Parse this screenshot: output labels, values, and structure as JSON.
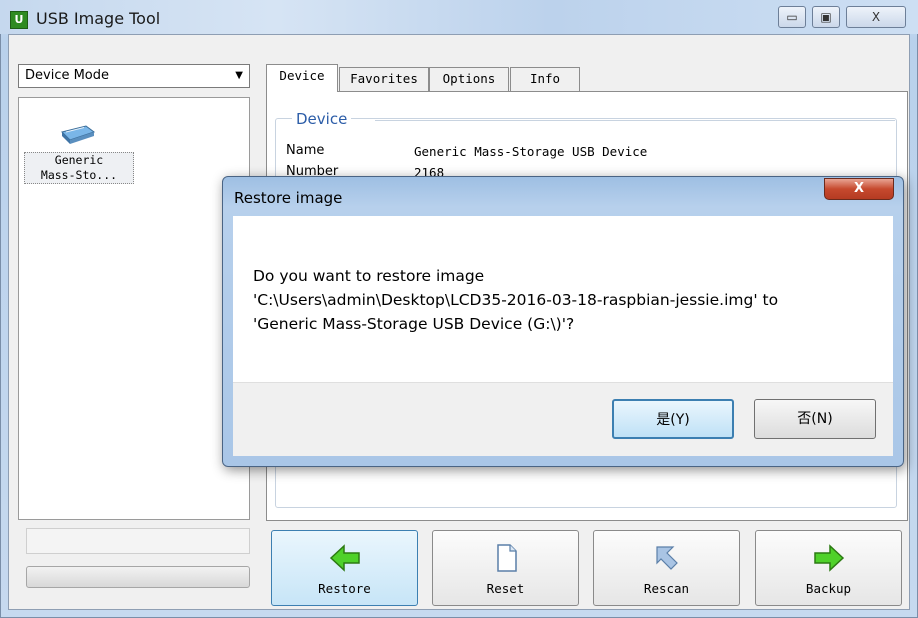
{
  "window": {
    "title": "USB Image Tool",
    "app_icon": "U",
    "minimize": "▭",
    "maximize": "▣",
    "close": "X"
  },
  "left_panel": {
    "mode_select": "Device Mode",
    "devices": [
      {
        "label_line1": "Generic",
        "label_line2": "Mass-Sto...",
        "icon": "usb-drive-icon"
      }
    ]
  },
  "tabs": [
    "Device",
    "Favorites",
    "Options",
    "Info"
  ],
  "device_panel": {
    "group_title": "Device",
    "rows": [
      {
        "label": "Name",
        "value": "Generic Mass-Storage USB Device"
      },
      {
        "label": "Number",
        "value": "2168"
      }
    ]
  },
  "buttons": [
    {
      "label": "Restore",
      "icon": "green-arrow-left-icon"
    },
    {
      "label": "Reset",
      "icon": "document-icon"
    },
    {
      "label": "Rescan",
      "icon": "rescan-arrow-icon"
    },
    {
      "label": "Backup",
      "icon": "green-arrow-right-icon"
    }
  ],
  "dialog": {
    "title": "Restore image",
    "close": "X",
    "message_line1": "Do you want to restore image",
    "message_line2": "'C:\\Users\\admin\\Desktop\\LCD35-2016-03-18-raspbian-jessie.img' to",
    "message_line3": "'Generic Mass-Storage USB Device (G:\\)'?",
    "yes": "是(Y)",
    "no": "否(N)"
  },
  "colors": {
    "group_title": "#2c5da8",
    "accent_green": "#3fbf1f",
    "close_red": "#c6492e"
  }
}
